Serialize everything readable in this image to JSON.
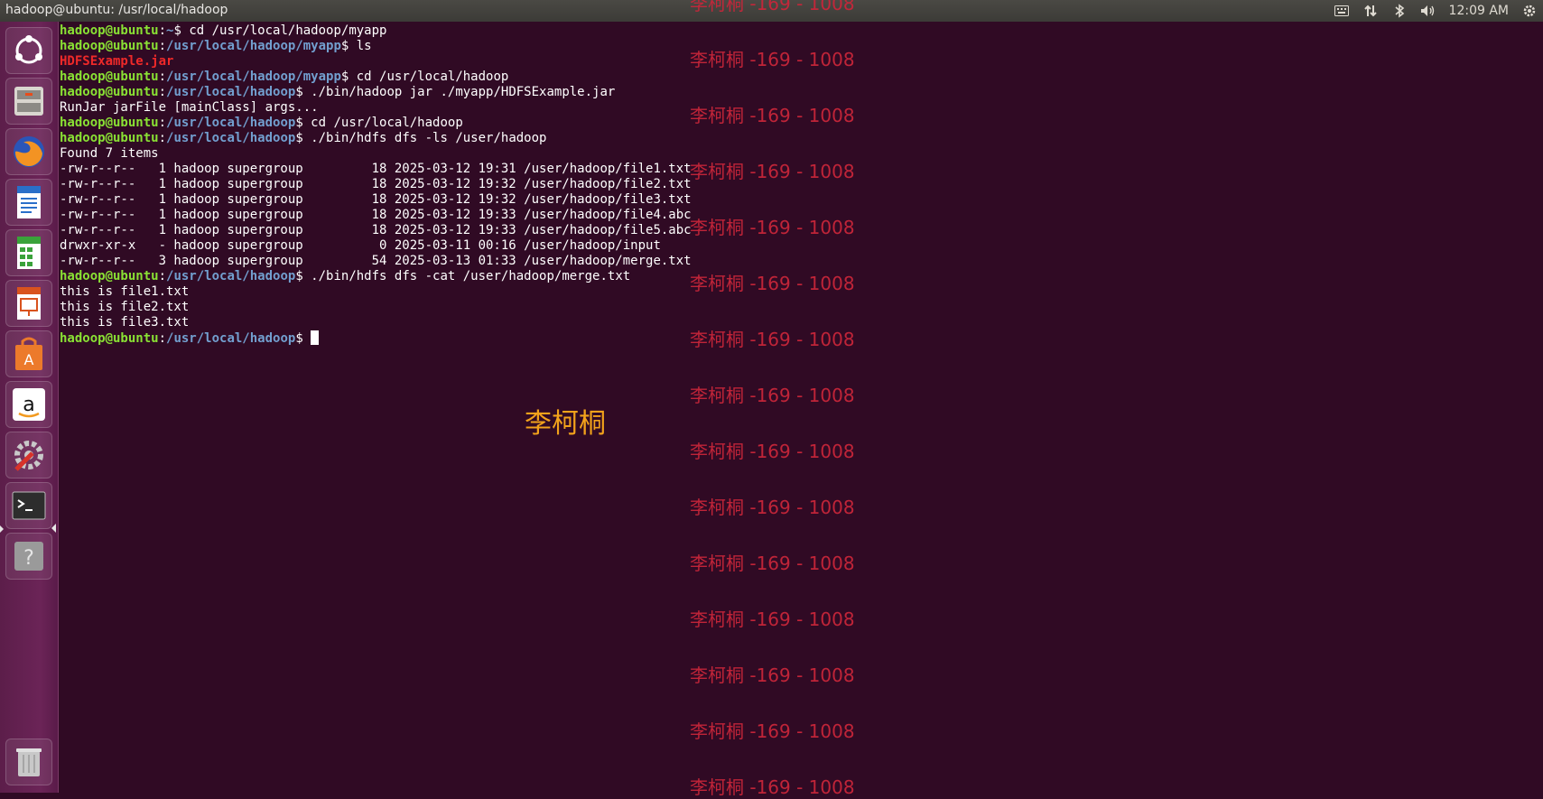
{
  "window": {
    "title": "hadoop@ubuntu: /usr/local/hadoop"
  },
  "tray": {
    "clock": "12:09 AM"
  },
  "launcher": [
    "ubuntu-dash",
    "files",
    "firefox",
    "libreoffice-writer",
    "libreoffice-calc",
    "libreoffice-impress",
    "ubuntu-software",
    "amazon",
    "system-settings",
    "terminal",
    "help",
    "trash"
  ],
  "terminal": {
    "lines": [
      {
        "user": "hadoop@ubuntu",
        "path": "~",
        "cmd": "cd /usr/local/hadoop/myapp"
      },
      {
        "user": "hadoop@ubuntu",
        "path": "/usr/local/hadoop/myapp",
        "cmd": "ls"
      },
      {
        "jar": "HDFSExample.jar"
      },
      {
        "user": "hadoop@ubuntu",
        "path": "/usr/local/hadoop/myapp",
        "cmd": "cd /usr/local/hadoop"
      },
      {
        "user": "hadoop@ubuntu",
        "path": "/usr/local/hadoop",
        "cmd": "./bin/hadoop jar ./myapp/HDFSExample.jar"
      },
      {
        "out": "RunJar jarFile [mainClass] args..."
      },
      {
        "user": "hadoop@ubuntu",
        "path": "/usr/local/hadoop",
        "cmd": "cd /usr/local/hadoop"
      },
      {
        "user": "hadoop@ubuntu",
        "path": "/usr/local/hadoop",
        "cmd": "./bin/hdfs dfs -ls /user/hadoop"
      },
      {
        "out": "Found 7 items"
      },
      {
        "out": "-rw-r--r--   1 hadoop supergroup         18 2025-03-12 19:31 /user/hadoop/file1.txt"
      },
      {
        "out": "-rw-r--r--   1 hadoop supergroup         18 2025-03-12 19:32 /user/hadoop/file2.txt"
      },
      {
        "out": "-rw-r--r--   1 hadoop supergroup         18 2025-03-12 19:32 /user/hadoop/file3.txt"
      },
      {
        "out": "-rw-r--r--   1 hadoop supergroup         18 2025-03-12 19:33 /user/hadoop/file4.abc"
      },
      {
        "out": "-rw-r--r--   1 hadoop supergroup         18 2025-03-12 19:33 /user/hadoop/file5.abc"
      },
      {
        "out": "drwxr-xr-x   - hadoop supergroup          0 2025-03-11 00:16 /user/hadoop/input"
      },
      {
        "out": "-rw-r--r--   3 hadoop supergroup         54 2025-03-13 01:33 /user/hadoop/merge.txt"
      },
      {
        "user": "hadoop@ubuntu",
        "path": "/usr/local/hadoop",
        "cmd": "./bin/hdfs dfs -cat /user/hadoop/merge.txt"
      },
      {
        "out": "this is file1.txt"
      },
      {
        "out": "this is file2.txt"
      },
      {
        "out": "this is file3.txt"
      },
      {
        "user": "hadoop@ubuntu",
        "path": "/usr/local/hadoop",
        "cmd": "",
        "cursor": true
      }
    ]
  },
  "watermark": {
    "text": "李柯桐 -169 - 1008",
    "count": 15
  },
  "center_name": "李柯桐",
  "colors": {
    "bg": "#300a24",
    "user": "#8ae234",
    "path": "#729fcf",
    "jar": "#ef2929",
    "watermark": "#c8263a",
    "name": "#f2a21b"
  }
}
